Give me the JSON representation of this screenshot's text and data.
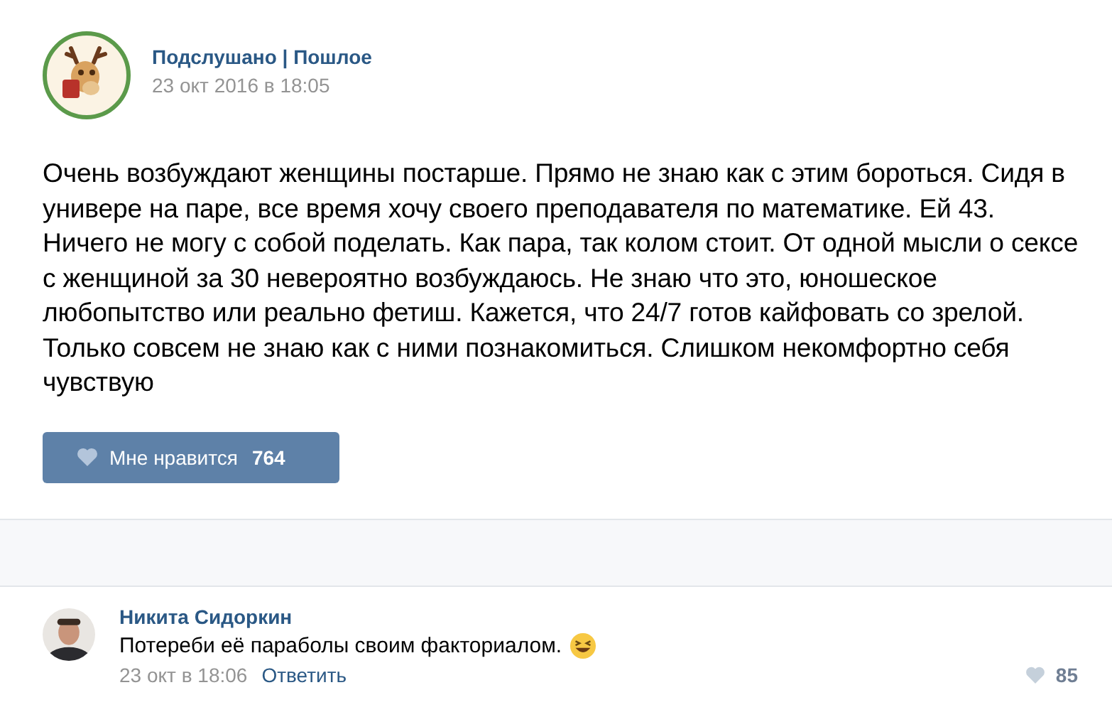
{
  "post": {
    "author": "Подслушано | Пошлое",
    "date": "23 окт 2016 в 18:05",
    "text": "Очень возбуждают женщины постарше. Прямо не знаю как с этим бороться. Сидя в универе на паре, все время хочу своего преподавателя по математике. Ей 43. Ничего не могу с собой поделать. Как пара, так колом стоит. От одной мысли о сексе с женщиной за 30 невероятно возбуждаюсь. Не знаю что это, юношеское любопытство или реально фетиш. Кажется, что 24/7 готов кайфовать со зрелой. Только совсем не знаю как с ними познакомиться. Слишком некомфортно себя чувствую",
    "like": {
      "label": "Мне нравится",
      "count": "764",
      "liked": false
    }
  },
  "comments": [
    {
      "author": "Никита Сидоркин",
      "text": "Потереби её параболы своим факториалом.",
      "emoji": true,
      "date": "23 окт в 18:06",
      "reply": "Ответить",
      "likes": "85",
      "liked": false
    }
  ]
}
